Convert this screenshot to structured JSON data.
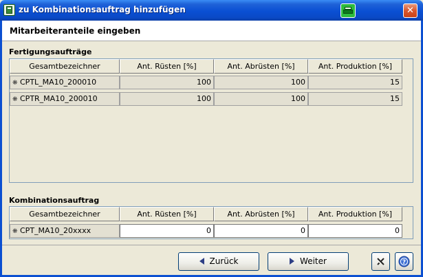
{
  "window": {
    "title": "zu Kombinationsauftrag hinzufügen",
    "close_glyph": "✕",
    "icons": {
      "app": "app-icon",
      "print": "print-icon",
      "close": "close-icon"
    }
  },
  "header": {
    "title": "Mitarbeiteranteile eingeben"
  },
  "fertigung": {
    "label": "Fertigungsaufträge",
    "columns": [
      "Gesamtbezeichner",
      "Ant. Rüsten [%]",
      "Ant. Abrüsten [%]",
      "Ant. Produktion [%]"
    ],
    "rows": [
      {
        "name": "CPTL_MA10_200010",
        "ruesten": "100",
        "abruesten": "100",
        "produktion": "15"
      },
      {
        "name": "CPTR_MA10_200010",
        "ruesten": "100",
        "abruesten": "100",
        "produktion": "15"
      }
    ]
  },
  "kombination": {
    "label": "Kombinationsauftrag",
    "columns": [
      "Gesamtbezeichner",
      "Ant. Rüsten [%]",
      "Ant. Abrüsten [%]",
      "Ant. Produktion [%]"
    ],
    "rows": [
      {
        "name": "CPT_MA10_20xxxx",
        "ruesten": "0",
        "abruesten": "0",
        "produktion": "0"
      }
    ]
  },
  "buttons": {
    "back": "Zurück",
    "next": "Weiter",
    "cancel_icon": "cancel-icon",
    "help_icon": "help-icon"
  },
  "row_marker": "❋"
}
